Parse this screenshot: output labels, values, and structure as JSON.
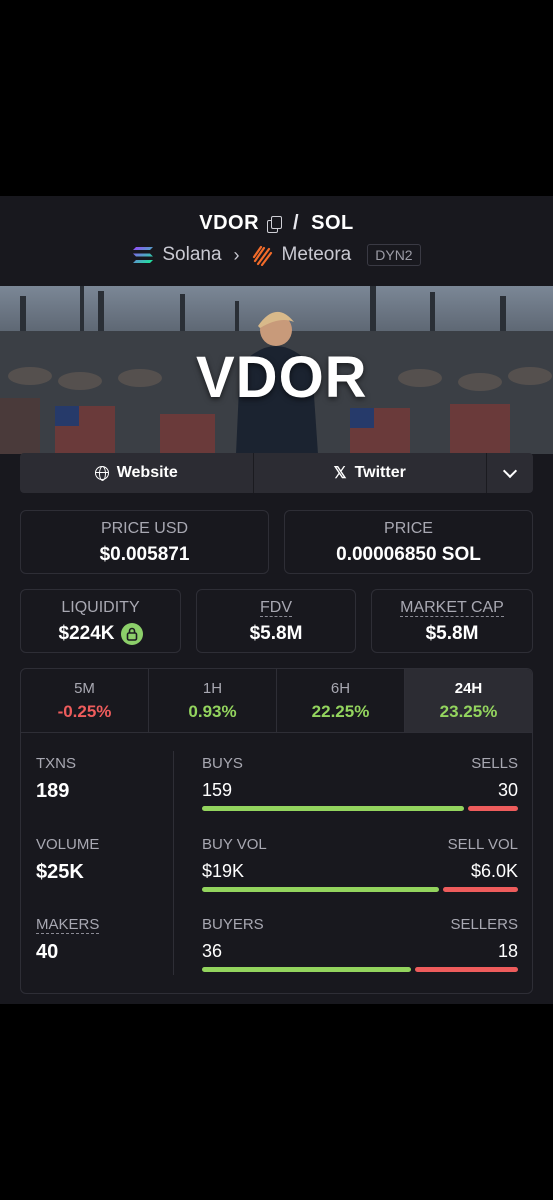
{
  "pair": {
    "base": "VDOR",
    "separator": "/",
    "quote": "SOL"
  },
  "chain": {
    "name": "Solana",
    "dex": "Meteora",
    "pool_tag": "DYN2"
  },
  "banner": {
    "logo_text": "VDOR"
  },
  "links": {
    "website": "Website",
    "twitter": "Twitter"
  },
  "price": {
    "usd_label": "PRICE USD",
    "usd_value": "$0.005871",
    "native_label": "PRICE",
    "native_value": "0.00006850 SOL"
  },
  "metrics": {
    "liquidity_label": "LIQUIDITY",
    "liquidity_value": "$224K",
    "fdv_label": "FDV",
    "fdv_value": "$5.8M",
    "mcap_label": "MARKET CAP",
    "mcap_value": "$5.8M"
  },
  "tabs": [
    {
      "label": "5M",
      "value": "-0.25%",
      "trend": "neg"
    },
    {
      "label": "1H",
      "value": "0.93%",
      "trend": "pos"
    },
    {
      "label": "6H",
      "value": "22.25%",
      "trend": "pos"
    },
    {
      "label": "24H",
      "value": "23.25%",
      "trend": "pos",
      "active": true
    }
  ],
  "stats": {
    "txns_label": "TXNS",
    "txns_value": "189",
    "volume_label": "VOLUME",
    "volume_value": "$25K",
    "makers_label": "MAKERS",
    "makers_value": "40"
  },
  "bars": {
    "buys_label": "BUYS",
    "buys_value": "159",
    "sells_label": "SELLS",
    "sells_value": "30",
    "buys_ratio": 0.84,
    "buyvol_label": "BUY VOL",
    "buyvol_value": "$19K",
    "sellvol_label": "SELL VOL",
    "sellvol_value": "$6.0K",
    "buyvol_ratio": 0.76,
    "buyers_label": "BUYERS",
    "buyers_value": "36",
    "sellers_label": "SELLERS",
    "sellers_value": "18",
    "buyers_ratio": 0.67
  },
  "colors": {
    "positive": "#93d45e",
    "negative": "#ee5c5c",
    "panel": "#18181e"
  }
}
